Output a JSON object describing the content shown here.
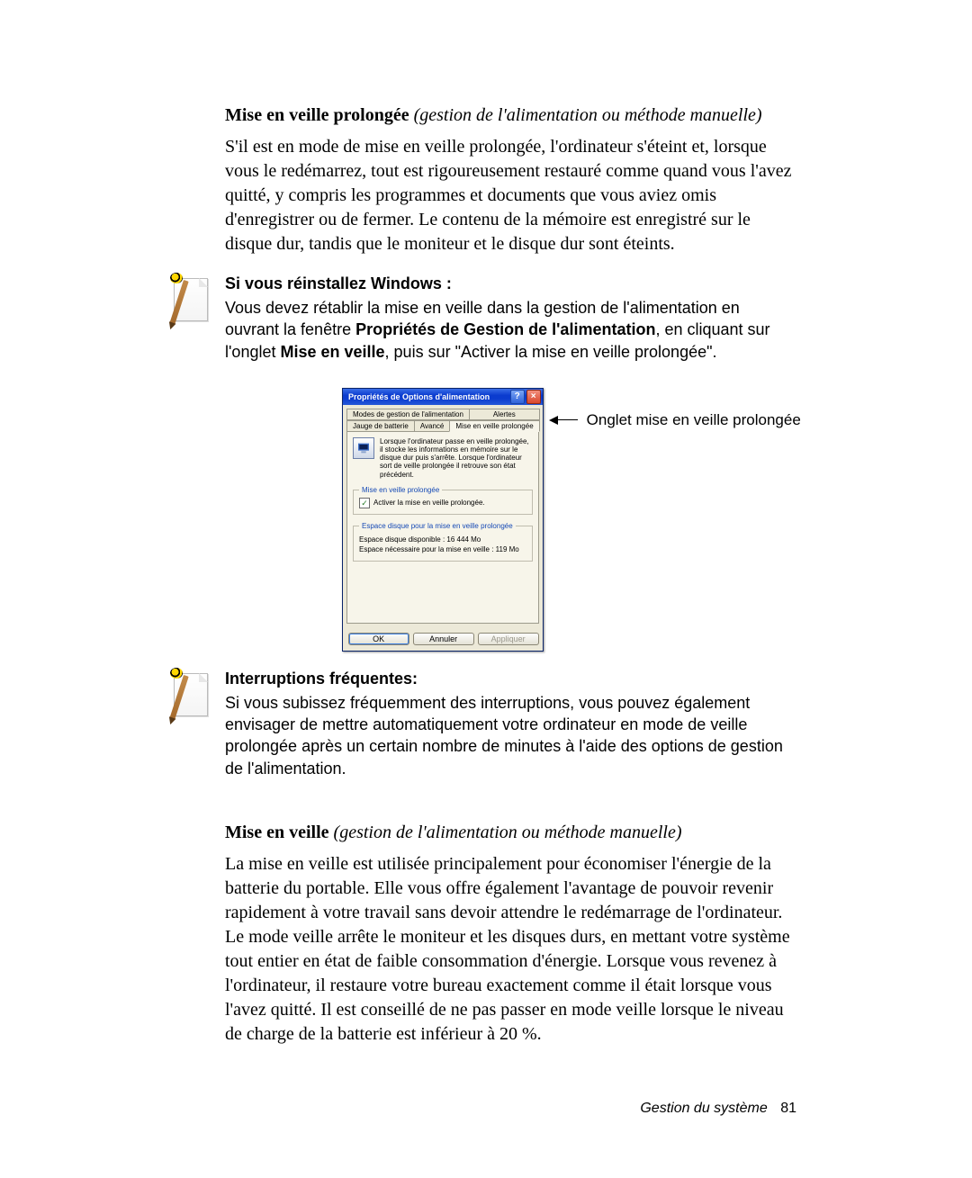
{
  "section1": {
    "heading_bold": "Mise en veille prolongée",
    "heading_ital": " (gestion de l'alimentation ou méthode manuelle)",
    "body": "S'il est en mode de mise en veille prolongée, l'ordinateur s'éteint et, lorsque vous le redémarrez, tout est rigoureusement restauré comme quand vous l'avez quitté, y compris les programmes et documents que vous aviez omis d'enregistrer ou de fermer. Le contenu de la mémoire est enregistré sur le disque dur, tandis que le moniteur et le disque dur sont éteints."
  },
  "note1": {
    "title": "Si vous réinstallez Windows :",
    "body_pre": "Vous devez rétablir la mise en veille dans la gestion de l'alimentation en ouvrant la fenêtre ",
    "body_bold1": "Propriétés de Gestion de l'alimentation",
    "body_mid": ", en cliquant sur l'onglet ",
    "body_bold2": "Mise en veille",
    "body_post": ", puis sur \"Activer la mise en veille prolongée\"."
  },
  "dialog": {
    "title": "Propriétés de Options d'alimentation",
    "tabs_top": [
      "Modes de gestion de l'alimentation",
      "Alertes"
    ],
    "tabs_bottom": [
      "Jauge de batterie",
      "Avancé",
      "Mise en veille prolongée"
    ],
    "active_tab": "Mise en veille prolongée",
    "description": "Lorsque l'ordinateur passe en veille prolongée, il stocke les informations en mémoire sur le disque dur puis s'arrête. Lorsque l'ordinateur sort de veille prolongée il retrouve son état précédent.",
    "group1_legend": "Mise en veille prolongée",
    "checkbox_label": "Activer la mise en veille prolongée.",
    "checkbox_checked": true,
    "group2_legend": "Espace disque pour la mise en veille prolongée",
    "space_available_label": "Espace disque disponible :",
    "space_available_value": "16 444 Mo",
    "space_required_label": "Espace nécessaire pour la mise en veille :",
    "space_required_value": "119 Mo",
    "btn_ok": "OK",
    "btn_cancel": "Annuler",
    "btn_apply": "Appliquer"
  },
  "callout_label": "Onglet mise en veille prolongée",
  "note2": {
    "title": "Interruptions fréquentes:",
    "body": "Si vous subissez fréquemment des interruptions, vous pouvez également envisager de mettre automatiquement votre ordinateur en mode de veille prolongée après un certain nombre de minutes à l'aide des options de gestion de l'alimentation."
  },
  "section2": {
    "heading_bold": "Mise en veille",
    "heading_ital": " (gestion de l'alimentation ou méthode manuelle)",
    "body": "La mise en veille est utilisée principalement pour économiser l'énergie de la batterie du portable. Elle vous offre également l'avantage de pouvoir revenir rapidement à votre travail sans devoir attendre le redémarrage de l'ordinateur. Le mode veille arrête le moniteur et les disques durs, en mettant votre système tout entier en état de faible consommation d'énergie. Lorsque vous revenez à l'ordinateur, il restaure votre bureau exactement comme il était lorsque vous l'avez quitté. Il est conseillé de ne pas passer en mode veille lorsque le niveau de charge de la batterie est inférieur à 20 %."
  },
  "footer": {
    "section": "Gestion du système",
    "page": "81"
  }
}
